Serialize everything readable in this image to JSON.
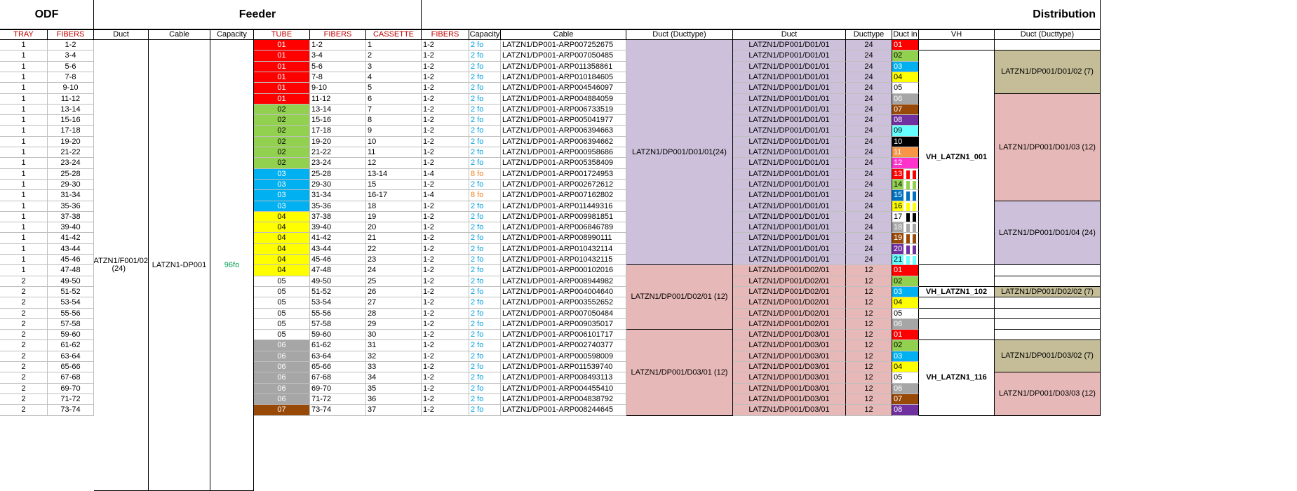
{
  "sections": {
    "odf": "ODF",
    "feeder": "Feeder",
    "distribution": "Distribution"
  },
  "headers": {
    "tray": "TRAY",
    "odf_fibers": "FIBERS",
    "duct": "Duct",
    "cable": "Cable",
    "capacity": "Capacity",
    "tube": "TUBE",
    "feeder_fibers": "FIBERS",
    "cassette": "CASSETTE",
    "dist_fibers": "FIBERS",
    "dist_capacity": "Capacity",
    "dist_cable": "Cable",
    "duct_ducttype": "Duct (Ducttype)",
    "dist_duct": "Duct",
    "ducttype": "Ducttype",
    "duct_in": "Duct in",
    "vh": "VH",
    "vh_duct_ducttype": "Duct (Ducttype)"
  },
  "feeder_merged": {
    "duct": "LATZN1/F001/02 (24)",
    "cable": "LATZN1-DP001",
    "capacity": "96fo"
  },
  "colors": {
    "01": "#ff0000",
    "02": "#92d050",
    "03": "#00b0f0",
    "04": "#ffff00",
    "05": "#ffffff",
    "06": "#a6a6a6",
    "07": "#984807",
    "08": "#7030a0",
    "09": "#66ffff",
    "10": "#000000",
    "11": "#f79646",
    "12": "#ff33cc",
    "13": "#ff0000",
    "14": "#92d050",
    "15": "#0070c0",
    "16": "#ffff00",
    "17": "#ffffff",
    "18": "#a6a6a6",
    "19": "#984807",
    "20": "#7030a0",
    "21": "#66ffff",
    "lilac": "#ccc0da",
    "pink": "#e6b8b7",
    "khaki": "#c4bd97"
  },
  "rows": [
    {
      "tray": "1",
      "fibers": "1-2",
      "tube": "01",
      "ffibers": "1-2",
      "cassette": "1",
      "dfibers": "1-2",
      "cap": "2 fo",
      "cable": "LATZN1/DP001-ARP007252675",
      "duct": "LATZN1/DP001/D01/01",
      "dtype": "24",
      "ductin": "01"
    },
    {
      "tray": "1",
      "fibers": "3-4",
      "tube": "01",
      "ffibers": "3-4",
      "cassette": "2",
      "dfibers": "1-2",
      "cap": "2 fo",
      "cable": "LATZN1/DP001-ARP007050485",
      "duct": "LATZN1/DP001/D01/01",
      "dtype": "24",
      "ductin": "02"
    },
    {
      "tray": "1",
      "fibers": "5-6",
      "tube": "01",
      "ffibers": "5-6",
      "cassette": "3",
      "dfibers": "1-2",
      "cap": "2 fo",
      "cable": "LATZN1/DP001-ARP011358861",
      "duct": "LATZN1/DP001/D01/01",
      "dtype": "24",
      "ductin": "03"
    },
    {
      "tray": "1",
      "fibers": "7-8",
      "tube": "01",
      "ffibers": "7-8",
      "cassette": "4",
      "dfibers": "1-2",
      "cap": "2 fo",
      "cable": "LATZN1/DP001-ARP010184605",
      "duct": "LATZN1/DP001/D01/01",
      "dtype": "24",
      "ductin": "04"
    },
    {
      "tray": "1",
      "fibers": "9-10",
      "tube": "01",
      "ffibers": "9-10",
      "cassette": "5",
      "dfibers": "1-2",
      "cap": "2 fo",
      "cable": "LATZN1/DP001-ARP004546097",
      "duct": "LATZN1/DP001/D01/01",
      "dtype": "24",
      "ductin": "05"
    },
    {
      "tray": "1",
      "fibers": "11-12",
      "tube": "01",
      "ffibers": "11-12",
      "cassette": "6",
      "dfibers": "1-2",
      "cap": "2 fo",
      "cable": "LATZN1/DP001-ARP004884059",
      "duct": "LATZN1/DP001/D01/01",
      "dtype": "24",
      "ductin": "06"
    },
    {
      "tray": "1",
      "fibers": "13-14",
      "tube": "02",
      "ffibers": "13-14",
      "cassette": "7",
      "dfibers": "1-2",
      "cap": "2 fo",
      "cable": "LATZN1/DP001-ARP006733519",
      "duct": "LATZN1/DP001/D01/01",
      "dtype": "24",
      "ductin": "07"
    },
    {
      "tray": "1",
      "fibers": "15-16",
      "tube": "02",
      "ffibers": "15-16",
      "cassette": "8",
      "dfibers": "1-2",
      "cap": "2 fo",
      "cable": "LATZN1/DP001-ARP005041977",
      "duct": "LATZN1/DP001/D01/01",
      "dtype": "24",
      "ductin": "08"
    },
    {
      "tray": "1",
      "fibers": "17-18",
      "tube": "02",
      "ffibers": "17-18",
      "cassette": "9",
      "dfibers": "1-2",
      "cap": "2 fo",
      "cable": "LATZN1/DP001-ARP006394663",
      "duct": "LATZN1/DP001/D01/01",
      "dtype": "24",
      "ductin": "09"
    },
    {
      "tray": "1",
      "fibers": "19-20",
      "tube": "02",
      "ffibers": "19-20",
      "cassette": "10",
      "dfibers": "1-2",
      "cap": "2 fo",
      "cable": "LATZN1/DP001-ARP006394662",
      "duct": "LATZN1/DP001/D01/01",
      "dtype": "24",
      "ductin": "10"
    },
    {
      "tray": "1",
      "fibers": "21-22",
      "tube": "02",
      "ffibers": "21-22",
      "cassette": "11",
      "dfibers": "1-2",
      "cap": "2 fo",
      "cable": "LATZN1/DP001-ARP000958686",
      "duct": "LATZN1/DP001/D01/01",
      "dtype": "24",
      "ductin": "11"
    },
    {
      "tray": "1",
      "fibers": "23-24",
      "tube": "02",
      "ffibers": "23-24",
      "cassette": "12",
      "dfibers": "1-2",
      "cap": "2 fo",
      "cable": "LATZN1/DP001-ARP005358409",
      "duct": "LATZN1/DP001/D01/01",
      "dtype": "24",
      "ductin": "12"
    },
    {
      "tray": "1",
      "fibers": "25-28",
      "tube": "03",
      "ffibers": "25-28",
      "cassette": "13-14",
      "dfibers": "1-4",
      "cap": "8 fo",
      "cable": "LATZN1/DP001-ARP001724953",
      "duct": "LATZN1/DP001/D01/01",
      "dtype": "24",
      "ductin": "13"
    },
    {
      "tray": "1",
      "fibers": "29-30",
      "tube": "03",
      "ffibers": "29-30",
      "cassette": "15",
      "dfibers": "1-2",
      "cap": "2 fo",
      "cable": "LATZN1/DP001-ARP002672612",
      "duct": "LATZN1/DP001/D01/01",
      "dtype": "24",
      "ductin": "14"
    },
    {
      "tray": "1",
      "fibers": "31-34",
      "tube": "03",
      "ffibers": "31-34",
      "cassette": "16-17",
      "dfibers": "1-4",
      "cap": "8 fo",
      "cable": "LATZN1/DP001-ARP007162802",
      "duct": "LATZN1/DP001/D01/01",
      "dtype": "24",
      "ductin": "15"
    },
    {
      "tray": "1",
      "fibers": "35-36",
      "tube": "03",
      "ffibers": "35-36",
      "cassette": "18",
      "dfibers": "1-2",
      "cap": "2 fo",
      "cable": "LATZN1/DP001-ARP011449316",
      "duct": "LATZN1/DP001/D01/01",
      "dtype": "24",
      "ductin": "16"
    },
    {
      "tray": "1",
      "fibers": "37-38",
      "tube": "04",
      "ffibers": "37-38",
      "cassette": "19",
      "dfibers": "1-2",
      "cap": "2 fo",
      "cable": "LATZN1/DP001-ARP009981851",
      "duct": "LATZN1/DP001/D01/01",
      "dtype": "24",
      "ductin": "17"
    },
    {
      "tray": "1",
      "fibers": "39-40",
      "tube": "04",
      "ffibers": "39-40",
      "cassette": "20",
      "dfibers": "1-2",
      "cap": "2 fo",
      "cable": "LATZN1/DP001-ARP006846789",
      "duct": "LATZN1/DP001/D01/01",
      "dtype": "24",
      "ductin": "18"
    },
    {
      "tray": "1",
      "fibers": "41-42",
      "tube": "04",
      "ffibers": "41-42",
      "cassette": "21",
      "dfibers": "1-2",
      "cap": "2 fo",
      "cable": "LATZN1/DP001-ARP008990111",
      "duct": "LATZN1/DP001/D01/01",
      "dtype": "24",
      "ductin": "19"
    },
    {
      "tray": "1",
      "fibers": "43-44",
      "tube": "04",
      "ffibers": "43-44",
      "cassette": "22",
      "dfibers": "1-2",
      "cap": "2 fo",
      "cable": "LATZN1/DP001-ARP010432114",
      "duct": "LATZN1/DP001/D01/01",
      "dtype": "24",
      "ductin": "20"
    },
    {
      "tray": "1",
      "fibers": "45-46",
      "tube": "04",
      "ffibers": "45-46",
      "cassette": "23",
      "dfibers": "1-2",
      "cap": "2 fo",
      "cable": "LATZN1/DP001-ARP010432115",
      "duct": "LATZN1/DP001/D01/01",
      "dtype": "24",
      "ductin": "21"
    },
    {
      "tray": "1",
      "fibers": "47-48",
      "tube": "04",
      "ffibers": "47-48",
      "cassette": "24",
      "dfibers": "1-2",
      "cap": "2 fo",
      "cable": "LATZN1/DP001-ARP000102016",
      "duct": "LATZN1/DP001/D02/01",
      "dtype": "12",
      "ductin": "01"
    },
    {
      "tray": "2",
      "fibers": "49-50",
      "tube": "05",
      "ffibers": "49-50",
      "cassette": "25",
      "dfibers": "1-2",
      "cap": "2 fo",
      "cable": "LATZN1/DP001-ARP008944982",
      "duct": "LATZN1/DP001/D02/01",
      "dtype": "12",
      "ductin": "02"
    },
    {
      "tray": "2",
      "fibers": "51-52",
      "tube": "05",
      "ffibers": "51-52",
      "cassette": "26",
      "dfibers": "1-2",
      "cap": "2 fo",
      "cable": "LATZN1/DP001-ARP004004640",
      "duct": "LATZN1/DP001/D02/01",
      "dtype": "12",
      "ductin": "03"
    },
    {
      "tray": "2",
      "fibers": "53-54",
      "tube": "05",
      "ffibers": "53-54",
      "cassette": "27",
      "dfibers": "1-2",
      "cap": "2 fo",
      "cable": "LATZN1/DP001-ARP003552652",
      "duct": "LATZN1/DP001/D02/01",
      "dtype": "12",
      "ductin": "04"
    },
    {
      "tray": "2",
      "fibers": "55-56",
      "tube": "05",
      "ffibers": "55-56",
      "cassette": "28",
      "dfibers": "1-2",
      "cap": "2 fo",
      "cable": "LATZN1/DP001-ARP007050484",
      "duct": "LATZN1/DP001/D02/01",
      "dtype": "12",
      "ductin": "05"
    },
    {
      "tray": "2",
      "fibers": "57-58",
      "tube": "05",
      "ffibers": "57-58",
      "cassette": "29",
      "dfibers": "1-2",
      "cap": "2 fo",
      "cable": "LATZN1/DP001-ARP009035017",
      "duct": "LATZN1/DP001/D02/01",
      "dtype": "12",
      "ductin": "06"
    },
    {
      "tray": "2",
      "fibers": "59-60",
      "tube": "05",
      "ffibers": "59-60",
      "cassette": "30",
      "dfibers": "1-2",
      "cap": "2 fo",
      "cable": "LATZN1/DP001-ARP006101717",
      "duct": "LATZN1/DP001/D03/01",
      "dtype": "12",
      "ductin": "01"
    },
    {
      "tray": "2",
      "fibers": "61-62",
      "tube": "06",
      "ffibers": "61-62",
      "cassette": "31",
      "dfibers": "1-2",
      "cap": "2 fo",
      "cable": "LATZN1/DP001-ARP002740377",
      "duct": "LATZN1/DP001/D03/01",
      "dtype": "12",
      "ductin": "02"
    },
    {
      "tray": "2",
      "fibers": "63-64",
      "tube": "06",
      "ffibers": "63-64",
      "cassette": "32",
      "dfibers": "1-2",
      "cap": "2 fo",
      "cable": "LATZN1/DP001-ARP000598009",
      "duct": "LATZN1/DP001/D03/01",
      "dtype": "12",
      "ductin": "03"
    },
    {
      "tray": "2",
      "fibers": "65-66",
      "tube": "06",
      "ffibers": "65-66",
      "cassette": "33",
      "dfibers": "1-2",
      "cap": "2 fo",
      "cable": "LATZN1/DP001-ARP011539740",
      "duct": "LATZN1/DP001/D03/01",
      "dtype": "12",
      "ductin": "04"
    },
    {
      "tray": "2",
      "fibers": "67-68",
      "tube": "06",
      "ffibers": "67-68",
      "cassette": "34",
      "dfibers": "1-2",
      "cap": "2 fo",
      "cable": "LATZN1/DP001-ARP008493113",
      "duct": "LATZN1/DP001/D03/01",
      "dtype": "12",
      "ductin": "05"
    },
    {
      "tray": "2",
      "fibers": "69-70",
      "tube": "06",
      "ffibers": "69-70",
      "cassette": "35",
      "dfibers": "1-2",
      "cap": "2 fo",
      "cable": "LATZN1/DP001-ARP004455410",
      "duct": "LATZN1/DP001/D03/01",
      "dtype": "12",
      "ductin": "06"
    },
    {
      "tray": "2",
      "fibers": "71-72",
      "tube": "06",
      "ffibers": "71-72",
      "cassette": "36",
      "dfibers": "1-2",
      "cap": "2 fo",
      "cable": "LATZN1/DP001-ARP004838792",
      "duct": "LATZN1/DP001/D03/01",
      "dtype": "12",
      "ductin": "07"
    },
    {
      "tray": "2",
      "fibers": "73-74",
      "tube": "07",
      "ffibers": "73-74",
      "cassette": "37",
      "dfibers": "1-2",
      "cap": "2 fo",
      "cable": "LATZN1/DP001-ARP008244645",
      "duct": "LATZN1/DP001/D03/01",
      "dtype": "12",
      "ductin": "08"
    }
  ],
  "duct_ducttype_groups": [
    {
      "label": "LATZN1/DP001/D01/01(24)",
      "start": 0,
      "end": 20,
      "color": "lilac"
    },
    {
      "label": "LATZN1/DP001/D02/01 (12)",
      "start": 21,
      "end": 26,
      "color": "pink"
    },
    {
      "label": "LATZN1/DP001/D03/01 (12)",
      "start": 27,
      "end": 34,
      "color": "pink"
    }
  ],
  "vh_groups": [
    {
      "label": "",
      "start": 0,
      "end": 0,
      "color": ""
    },
    {
      "label": "VH_LATZN1_001",
      "start": 1,
      "end": 20,
      "color": ""
    },
    {
      "label": "",
      "start": 21,
      "end": 22,
      "color": ""
    },
    {
      "label": "VH_LATZN1_102",
      "start": 23,
      "end": 23,
      "color": ""
    },
    {
      "label": "",
      "start": 24,
      "end": 24,
      "color": ""
    },
    {
      "label": "",
      "start": 25,
      "end": 25,
      "color": ""
    },
    {
      "label": "",
      "start": 26,
      "end": 27,
      "color": ""
    },
    {
      "label": "VH_LATZN1_116",
      "start": 28,
      "end": 34,
      "color": ""
    }
  ],
  "vh_duct_groups": [
    {
      "label": "",
      "start": 0,
      "end": 0,
      "color": ""
    },
    {
      "label": "LATZN1/DP001/D01/02 (7)",
      "start": 1,
      "end": 4,
      "color": "khaki"
    },
    {
      "label": "LATZN1/DP001/D01/03 (12)",
      "start": 5,
      "end": 14,
      "color": "pink"
    },
    {
      "label": "LATZN1/DP001/D01/04 (24)",
      "start": 15,
      "end": 20,
      "color": "lilac"
    },
    {
      "label": "",
      "start": 21,
      "end": 21,
      "color": ""
    },
    {
      "label": "",
      "start": 22,
      "end": 22,
      "color": ""
    },
    {
      "label": "LATZN1/DP001/D02/02 (7)",
      "start": 23,
      "end": 23,
      "color": "khaki"
    },
    {
      "label": "",
      "start": 24,
      "end": 24,
      "color": ""
    },
    {
      "label": "",
      "start": 25,
      "end": 25,
      "color": ""
    },
    {
      "label": "",
      "start": 26,
      "end": 26,
      "color": ""
    },
    {
      "label": "",
      "start": 27,
      "end": 27,
      "color": ""
    },
    {
      "label": "LATZN1/DP001/D03/02 (7)",
      "start": 28,
      "end": 30,
      "color": "khaki"
    },
    {
      "label": "LATZN1/DP001/D03/03 (12)",
      "start": 31,
      "end": 34,
      "color": "pink"
    }
  ]
}
